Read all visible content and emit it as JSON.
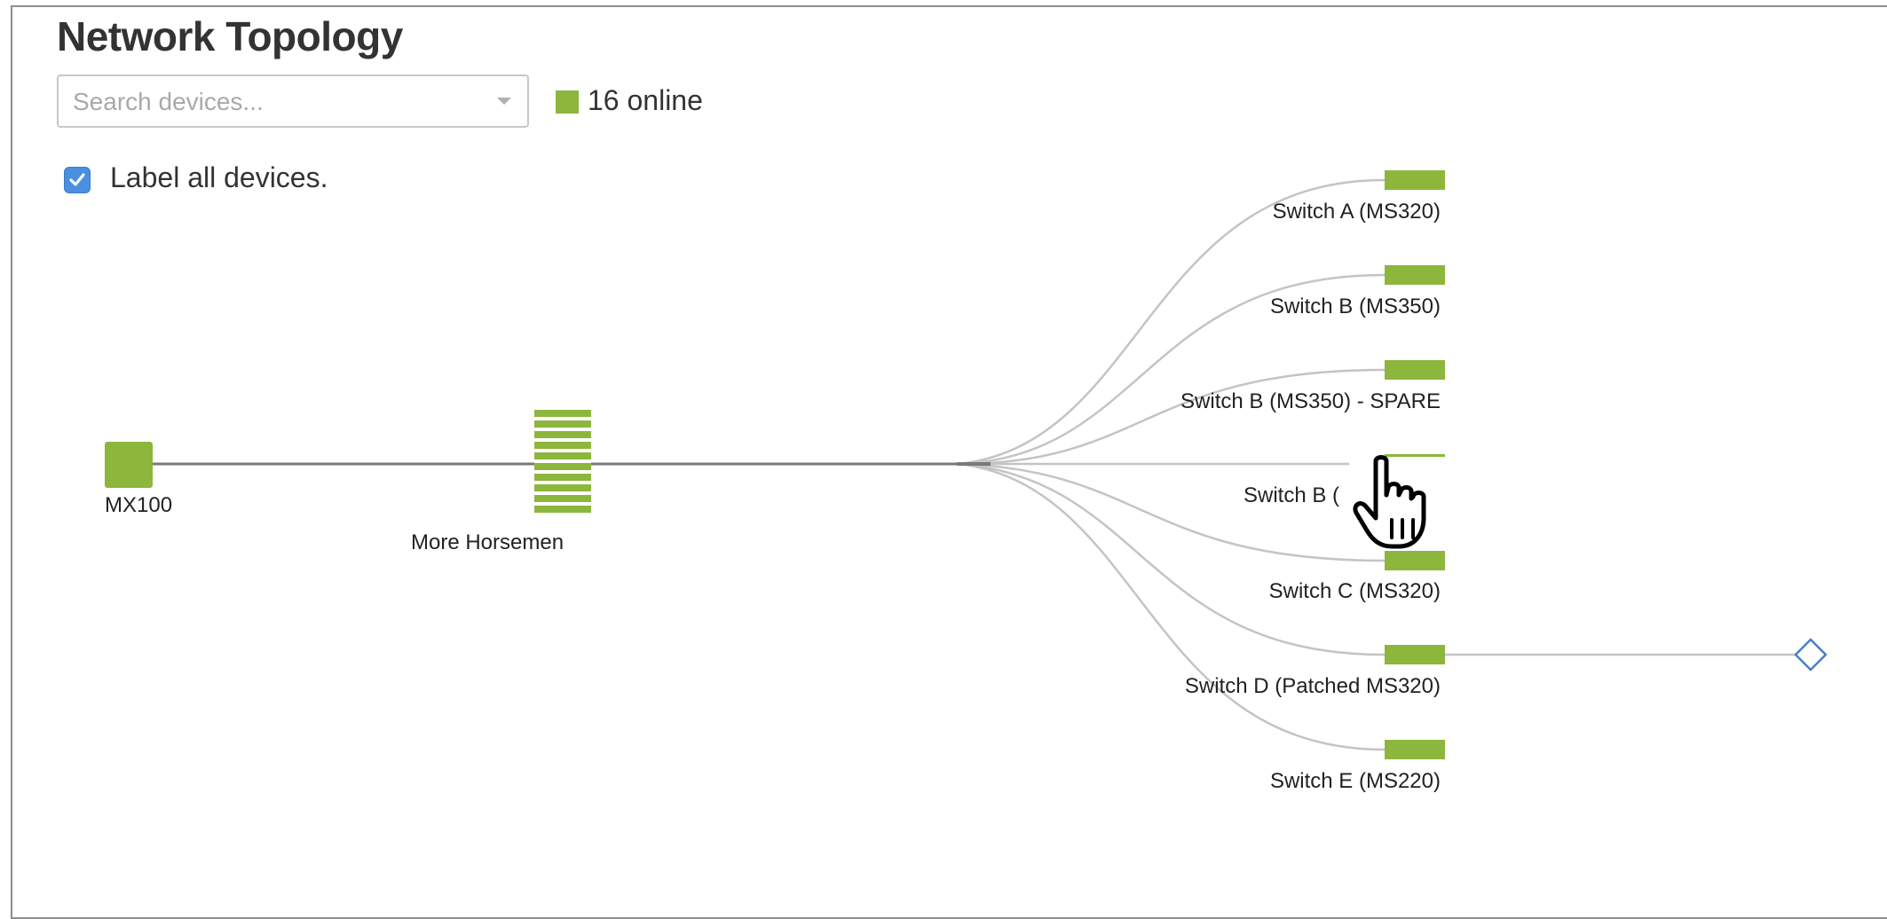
{
  "header": {
    "title": "Network Topology"
  },
  "search": {
    "placeholder": "Search devices...",
    "value": ""
  },
  "status": {
    "online_text": "16 online",
    "online_color": "#8db63c"
  },
  "options": {
    "label_all_checked": true,
    "label_all_text": "Label all devices."
  },
  "topology": {
    "link_color": "#c4c4c4",
    "trunk_color": "#7a7a7a",
    "device_color": "#8db63c",
    "client_color": "#4a7fc1",
    "devices": {
      "mx": {
        "label": "MX100",
        "icon": "security-appliance-icon"
      },
      "stack": {
        "label": "More Horsemen",
        "icon": "switch-stack-icon"
      },
      "switches": [
        {
          "label": "Switch A (MS320)",
          "icon": "switch-icon"
        },
        {
          "label": "Switch B (MS350)",
          "icon": "switch-icon"
        },
        {
          "label": "Switch B (MS350) - SPARE",
          "icon": "switch-icon"
        },
        {
          "label": "Switch B (",
          "icon": "switch-icon"
        },
        {
          "label": "Switch C (MS320)",
          "icon": "switch-icon"
        },
        {
          "label": "Switch D (Patched MS320)",
          "icon": "switch-icon"
        },
        {
          "label": "Switch E (MS220)",
          "icon": "switch-icon"
        }
      ],
      "client": {
        "icon": "client-device-diamond-icon"
      }
    }
  },
  "cursor": {
    "icon": "hand-pointer-cursor-icon"
  }
}
